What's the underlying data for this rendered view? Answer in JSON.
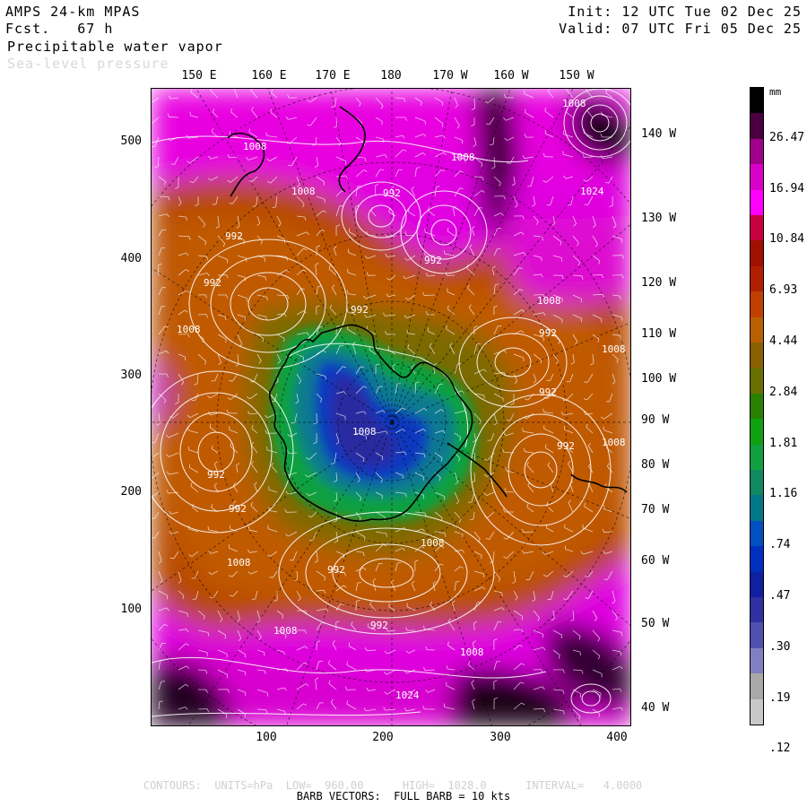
{
  "header": {
    "model": "AMPS 24-km MPAS",
    "forecast": "Fcst.   67 h",
    "field": "Precipitable water vapor",
    "overlay": "Sea-level pressure",
    "init": "Init: 12 UTC Tue 02 Dec 25",
    "valid": "Valid: 07 UTC Fri 05 Dec 25"
  },
  "axes": {
    "top_lon": [
      "150 E",
      "160 E",
      "170 E",
      "180",
      "170 W",
      "160 W",
      "150 W"
    ],
    "right_lon": [
      "140 W",
      "130 W",
      "120 W",
      "110 W",
      "100 W",
      "90 W",
      "80 W",
      "70 W",
      "60 W",
      "50 W",
      "40 W"
    ],
    "left_y": [
      "500",
      "400",
      "300",
      "200",
      "100"
    ],
    "bottom_x": [
      "100",
      "200",
      "300",
      "400"
    ]
  },
  "colorbar": {
    "unit": "mm",
    "labels": [
      "26.47",
      "16.94",
      "10.84",
      "6.93",
      "4.44",
      "2.84",
      "1.81",
      "1.16",
      ".74",
      ".47",
      ".30",
      ".19",
      ".12"
    ],
    "colors": [
      "#000000",
      "#4a0040",
      "#a0008a",
      "#d800c8",
      "#ff00ff",
      "#c80040",
      "#a01000",
      "#b02000",
      "#c04000",
      "#b86000",
      "#8a6000",
      "#6a7000",
      "#2a8000",
      "#10a010",
      "#10a040",
      "#108860",
      "#007888",
      "#0050c0",
      "#0030c0",
      "#1020a0",
      "#3030a0",
      "#5050b0",
      "#8080c0",
      "#a8a8a8",
      "#c8c8c8"
    ]
  },
  "pressure_labels": [
    "1008",
    "1008",
    "1008",
    "992",
    "1008",
    "1024",
    "992",
    "992",
    "1008",
    "992",
    "992",
    "1008",
    "992",
    "1008",
    "1008",
    "992",
    "992",
    "1008",
    "992",
    "992",
    "1008",
    "992",
    "1008",
    "1008",
    "992",
    "1008",
    "1024"
  ],
  "footer": {
    "contours": "CONTOURS:  UNITS=hPa  LOW=  960.00      HIGH=  1028.0      INTERVAL=   4.0000",
    "barbs": "BARB VECTORS:  FULL BARB = 10 kts"
  }
}
